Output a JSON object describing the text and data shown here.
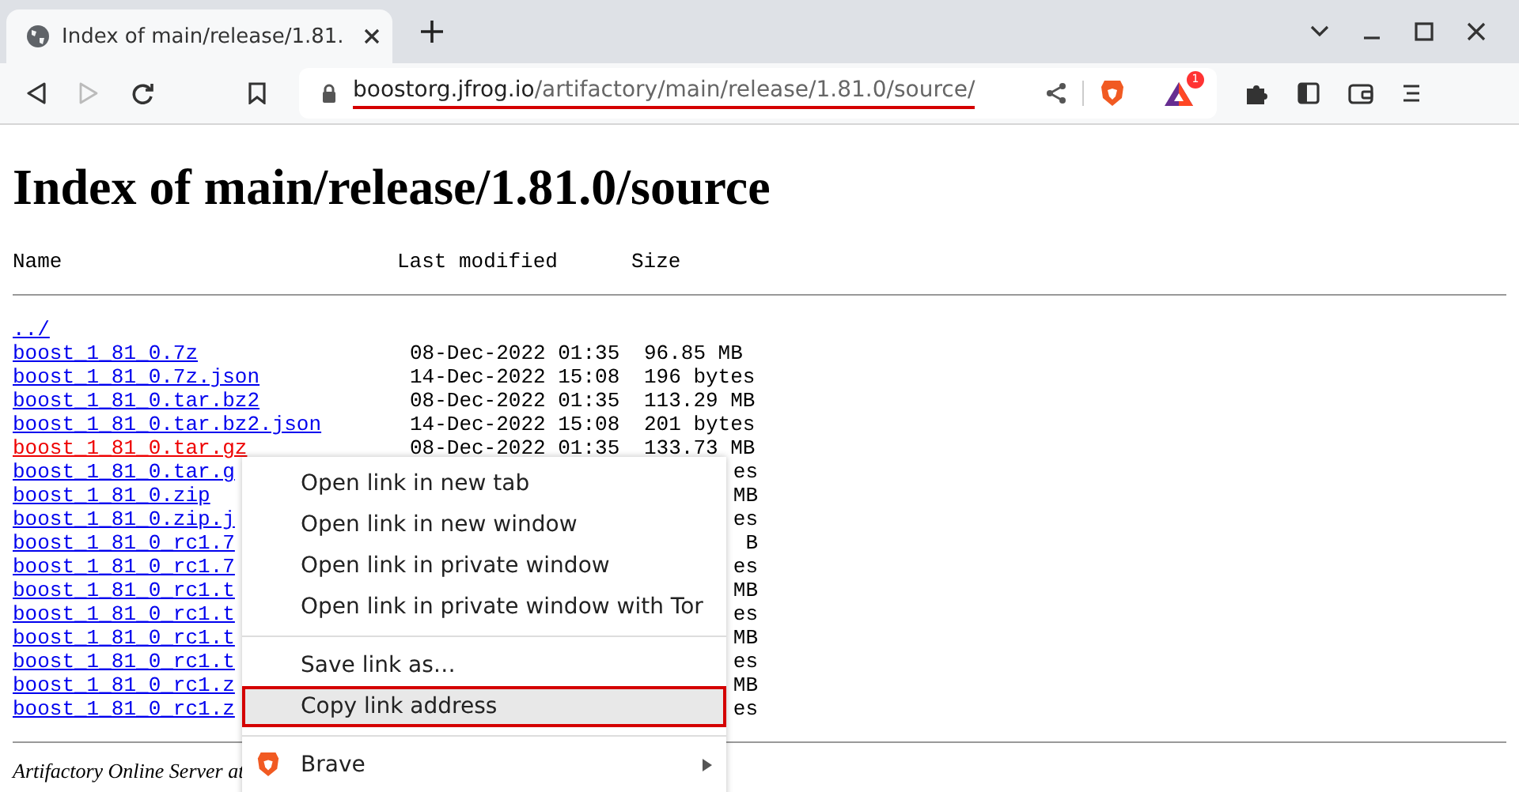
{
  "browser": {
    "tab": {
      "title": "Index of main/release/1.81.",
      "selected": true
    },
    "address": {
      "host": "boostorg.jfrog.io",
      "path": "/artifactory/main/release/1.81.0/source/",
      "underlined": true
    },
    "rewards_badge": "1"
  },
  "page": {
    "title": "Index of main/release/1.81.0/source",
    "columns": [
      "Name",
      "Last modified",
      "Size"
    ],
    "rows": [
      {
        "name": "../",
        "visited": false
      },
      {
        "name": "boost_1_81_0.7z",
        "modified": "08-Dec-2022 01:35",
        "size": "96.85 MB",
        "visited": false,
        "clipped": false
      },
      {
        "name": "boost_1_81_0.7z.json",
        "modified": "14-Dec-2022 15:08",
        "size": "196 bytes",
        "visited": false,
        "clipped": false
      },
      {
        "name": "boost_1_81_0.tar.bz2",
        "modified": "08-Dec-2022 01:35",
        "size": "113.29 MB",
        "visited": false,
        "clipped": false
      },
      {
        "name": "boost_1_81_0.tar.bz2.json",
        "modified": "14-Dec-2022 15:08",
        "size": "201 bytes",
        "visited": false,
        "clipped": false
      },
      {
        "name": "boost_1_81_0.tar.gz",
        "modified": "08-Dec-2022 01:35",
        "size": "133.73 MB",
        "visited": true,
        "clipped": false
      },
      {
        "name": "boost_1_81_0.tar.g",
        "size": "es",
        "visited": false,
        "clipped": true
      },
      {
        "name": "boost_1_81_0.zip",
        "size": "MB",
        "visited": false,
        "clipped": true
      },
      {
        "name": "boost_1_81_0.zip.j",
        "size": "es",
        "visited": false,
        "clipped": true
      },
      {
        "name": "boost_1_81_0_rc1.7",
        "size": "B",
        "visited": false,
        "clipped": true
      },
      {
        "name": "boost_1_81_0_rc1.7",
        "size": "es",
        "visited": false,
        "clipped": true
      },
      {
        "name": "boost_1_81_0_rc1.t",
        "size": "MB",
        "visited": false,
        "clipped": true
      },
      {
        "name": "boost_1_81_0_rc1.t",
        "size": "es",
        "visited": false,
        "clipped": true
      },
      {
        "name": "boost_1_81_0_rc1.t",
        "size": "MB",
        "visited": false,
        "clipped": true
      },
      {
        "name": "boost_1_81_0_rc1.t",
        "size": "es",
        "visited": false,
        "clipped": true
      },
      {
        "name": "boost_1_81_0_rc1.z",
        "size": "MB",
        "visited": false,
        "clipped": true
      },
      {
        "name": "boost_1_81_0_rc1.z",
        "size": "es",
        "visited": false,
        "clipped": true
      }
    ],
    "footer": "Artifactory Online Server at"
  },
  "context_menu": {
    "items": [
      {
        "kind": "item",
        "label": "Open link in new tab",
        "highlighted": false
      },
      {
        "kind": "item",
        "label": "Open link in new window",
        "highlighted": false
      },
      {
        "kind": "item",
        "label": "Open link in private window",
        "highlighted": false
      },
      {
        "kind": "item",
        "label": "Open link in private window with Tor",
        "highlighted": false
      },
      {
        "kind": "separator"
      },
      {
        "kind": "item",
        "label": "Save link as…",
        "highlighted": false
      },
      {
        "kind": "item",
        "label": "Copy link address",
        "highlighted": true
      },
      {
        "kind": "separator"
      },
      {
        "kind": "submenu",
        "label": "Brave",
        "highlighted": false
      }
    ]
  }
}
